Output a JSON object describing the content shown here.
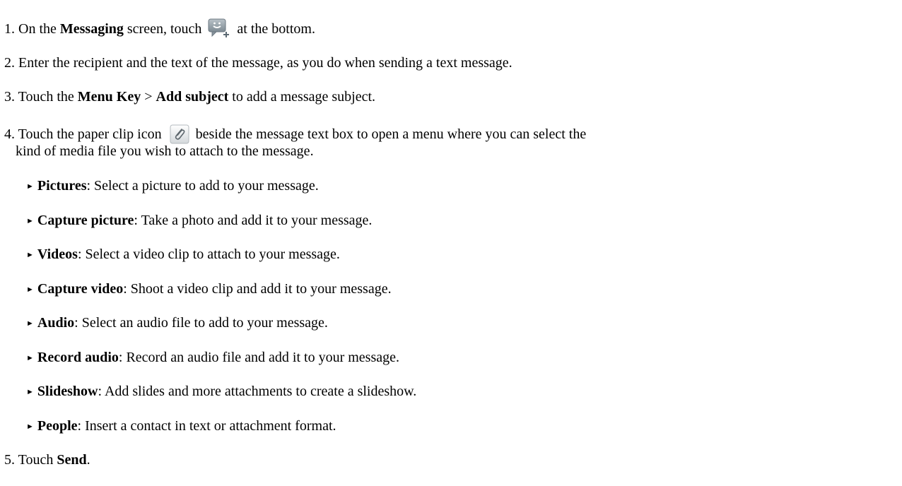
{
  "steps": [
    {
      "num": "1.",
      "pre": " On the ",
      "bold": "Messaging",
      "mid": " screen, touch",
      "icon": "new-message-icon",
      "post": " at the bottom."
    },
    {
      "num": "2.",
      "text": " Enter the recipient and the text of the message, as you do when sending a text message."
    },
    {
      "num": "3.",
      "pre": " Touch the ",
      "bold1": "Menu Key",
      "sep": " > ",
      "bold2": "Add subject",
      "post": " to add a message subject."
    },
    {
      "num": "4.",
      "pre": " Touch the paper clip icon",
      "icon": "paper-clip-icon",
      "post": " beside the message text box to open a menu where you can select the",
      "cont": "kind of media file you wish to attach to the message."
    },
    {
      "num": "5.",
      "pre": " Touch ",
      "bold": "Send",
      "post": "."
    }
  ],
  "bullets": [
    {
      "term": "Pictures",
      "desc": ": Select a picture to add to your message."
    },
    {
      "term": "Capture picture",
      "desc": ": Take a photo and add it to your message."
    },
    {
      "term": "Videos",
      "desc": ": Select a video clip to attach to your message."
    },
    {
      "term": "Capture video",
      "desc": ": Shoot a video clip and add it to your message."
    },
    {
      "term": "Audio",
      "desc": ": Select an audio file to add to your message."
    },
    {
      "term": "Record audio",
      "desc": ": Record an audio file and add it to your message."
    },
    {
      "term": "Slideshow",
      "desc": ": Add slides and more attachments to create a slideshow."
    },
    {
      "term": "People",
      "desc": ": Insert a contact in text or attachment format."
    }
  ],
  "bullet_marker": "►"
}
